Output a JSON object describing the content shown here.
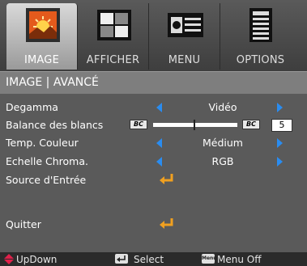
{
  "tabs": [
    {
      "label": "IMAGE",
      "icon": "image-icon",
      "active": true
    },
    {
      "label": "AFFICHER",
      "icon": "display-icon",
      "active": false
    },
    {
      "label": "MENU",
      "icon": "menu-icon",
      "active": false
    },
    {
      "label": "OPTIONS",
      "icon": "options-icon",
      "active": false
    }
  ],
  "subtitle": "IMAGE | AVANCÉ",
  "rows": [
    {
      "label": "Degamma",
      "value": "Vidéo"
    },
    {
      "label": "Balance des blancs",
      "bc_left": "BC",
      "bc_right": "BC",
      "value": "5",
      "slider_level_percent": 48
    },
    {
      "label": "Temp. Couleur",
      "value": "Médium"
    },
    {
      "label": "Echelle Chroma.",
      "value": "RGB"
    },
    {
      "label": "Source d'Entrée"
    },
    {
      "label": "Quitter"
    }
  ],
  "footer": {
    "updown": "UpDown",
    "select": "Select",
    "menu_key": "Menu",
    "menu_off": "Menu Off"
  },
  "colors": {
    "accent_arrow": "#2a8cf0",
    "enter_arrow": "#f0a020",
    "updown_icon": "#e0204a"
  }
}
